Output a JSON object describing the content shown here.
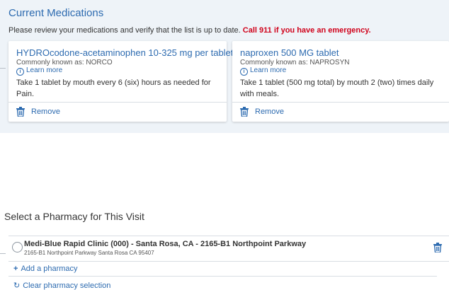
{
  "current_medications": {
    "title": "Current Medications",
    "notice": "Please review your medications and verify that the list is up to date. ",
    "warning": "Call 911 if you have an emergency.",
    "medications": [
      {
        "name": "HYDROcodone-acetaminophen 10-325 mg per tablet",
        "known_as": "Commonly known as: NORCO",
        "learn_more": "Learn more",
        "instructions": "Take 1 tablet by mouth every 6 (six) hours as needed for Pain.",
        "remove_label": "Remove"
      },
      {
        "name": "naproxen 500 MG tablet",
        "known_as": "Commonly known as: NAPROSYN",
        "learn_more": "Learn more",
        "instructions": "Take 1 tablet (500 mg total) by mouth 2 (two) times daily with meals.",
        "remove_label": "Remove"
      }
    ]
  },
  "pharmacy": {
    "title": "Select a Pharmacy for This Visit",
    "selected": false,
    "entries": [
      {
        "name": "Medi-Blue Rapid Clinic (000) - Santa Rosa, CA - 2165-B1 Northpoint Parkway",
        "address": "2165-B1 Northpoint Parkway Santa Rosa CA 95407"
      }
    ],
    "add_label": "Add a pharmacy",
    "clear_label": "Clear pharmacy selection"
  },
  "icons": {
    "trash": "trash-icon",
    "info": "info-icon",
    "plus": "plus-icon",
    "refresh": "refresh-icon"
  },
  "colors": {
    "accent": "#2d6bb0",
    "warning": "#d0021b",
    "panel_bg": "#eef3f8"
  }
}
